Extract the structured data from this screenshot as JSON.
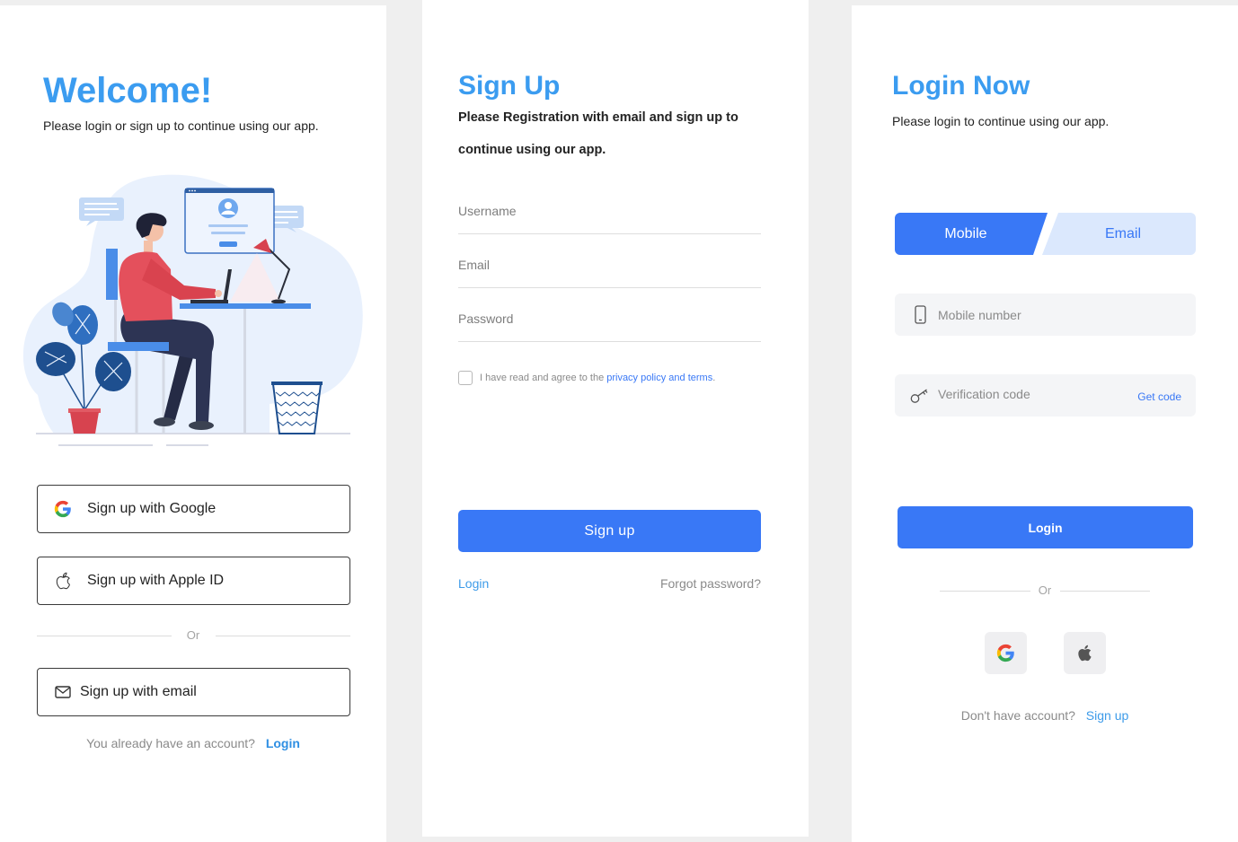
{
  "colors": {
    "page_bg": "#efefef",
    "title": "#3b9cf0",
    "primary": "#3978f6",
    "link": "#2f8fe3",
    "tab_inactive": "#dbe8fd",
    "input_bg": "#f4f5f7",
    "social_bg": "#efeff1",
    "muted": "#8a8a8a"
  },
  "welcome": {
    "title": "Welcome!",
    "subtitle": "Please login or sign up to continue using our app.",
    "google_button": {
      "label": "Sign up with Google",
      "icon": "google-icon"
    },
    "apple_button": {
      "label": "Sign up with Apple ID",
      "icon": "apple-icon"
    },
    "or_label": "Or",
    "email_button": {
      "label": "Sign up with email",
      "icon": "mail-icon"
    },
    "account_prompt": "You already have an account?",
    "login_link": "Login"
  },
  "signup": {
    "title": "Sign Up",
    "subtitle_lines": [
      "Please Registration with email and sign up to",
      "continue using our app."
    ],
    "fields": [
      {
        "placeholder": "Username",
        "value": ""
      },
      {
        "placeholder": "Email",
        "value": ""
      },
      {
        "placeholder": "Password",
        "value": ""
      }
    ],
    "agreement": {
      "checked": false,
      "text": "I have read and agree to the",
      "link": "privacy policy and terms",
      "suffix": "."
    },
    "submit_label": "Sign up",
    "login_link": "Login",
    "forgot_link": "Forgot password?"
  },
  "login": {
    "title": "Login Now",
    "subtitle": "Please login to continue using our app.",
    "tabs": [
      {
        "label": "Mobile",
        "active": true
      },
      {
        "label": "Email",
        "active": false
      }
    ],
    "mobile_field": {
      "placeholder": "Mobile number",
      "value": "",
      "icon": "phone-icon"
    },
    "code_field": {
      "placeholder": "Verification code",
      "value": "",
      "icon": "key-icon",
      "action": "Get code"
    },
    "submit_label": "Login",
    "or_label": "Or",
    "social": [
      {
        "icon": "google-icon"
      },
      {
        "icon": "apple-icon"
      }
    ],
    "signup_prompt": "Don't have account?",
    "signup_link": "Sign up"
  }
}
